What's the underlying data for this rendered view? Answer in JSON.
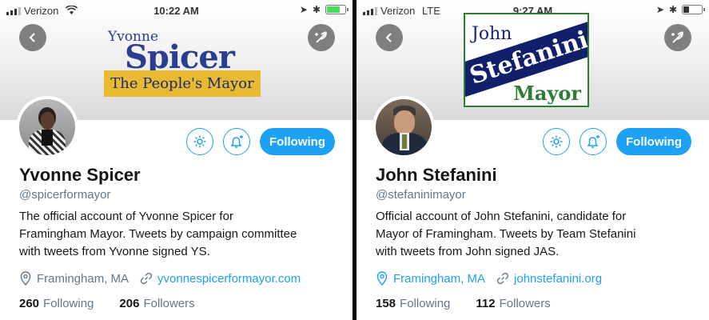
{
  "panels": [
    {
      "status": {
        "carrier": "Verizon",
        "time": "10:22 AM"
      },
      "logo": {
        "line1": "Yvonne",
        "line2": "Spicer",
        "tagline": "The People's Mayor"
      },
      "follow_label": "Following",
      "name": "Yvonne Spicer",
      "handle": "@spicerformayor",
      "bio": [
        "The official account of Yvonne Spicer for",
        "Framingham Mayor. Tweets by campaign committee",
        "with tweets from Yvonne signed YS."
      ],
      "location": "Framingham, MA",
      "website": "yvonnespicerformayor.com",
      "following_count": "260",
      "following_label": "Following",
      "followers_count": "206",
      "followers_label": "Followers"
    },
    {
      "status": {
        "carrier": "Verizon",
        "network": "LTE",
        "time": "9:27 AM"
      },
      "logo": {
        "line1": "John",
        "line2": "Stefanini",
        "tagline": "Mayor"
      },
      "follow_label": "Following",
      "name": "John Stefanini",
      "handle": "@stefaninimayor",
      "bio": [
        "Official account of John Stefanini, candidate for",
        "Mayor of Framingham. Tweets by Team Stefanini",
        "with tweets from John signed JAS."
      ],
      "location": "Framingham, MA",
      "website": "johnstefanini.org",
      "following_count": "158",
      "following_label": "Following",
      "followers_count": "112",
      "followers_label": "Followers"
    }
  ],
  "colors": {
    "accent": "#1da1f2",
    "text": "#14171a",
    "secondary": "#657786",
    "battery": "#4cd964"
  },
  "icons": [
    "back-arrow-icon",
    "compose-feather-icon",
    "gear-icon",
    "bell-plus-icon",
    "location-pin-icon",
    "link-icon"
  ]
}
